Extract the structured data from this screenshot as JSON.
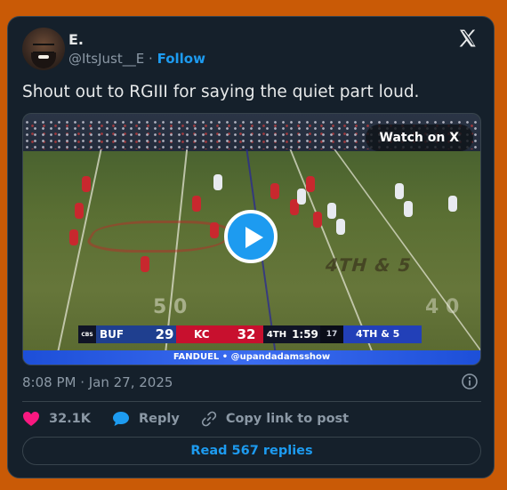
{
  "author": {
    "display_name": "E.",
    "handle": "@ItsJust__E",
    "separator": "·",
    "follow_label": "Follow"
  },
  "tweet": {
    "text": "Shout out to RGIII for saying the quiet part loud.",
    "timestamp": "8:08 PM · Jan 27, 2025"
  },
  "media": {
    "watch_label": "Watch on X",
    "scoreboard": {
      "network": "CBS",
      "away_team": "BUF",
      "away_score": "29",
      "home_team": "KC",
      "home_score": "32",
      "quarter": "4TH",
      "clock": "1:59",
      "play_clock": "17",
      "down": "4TH & 5"
    },
    "field_text": {
      "down_marker": "4TH & 5",
      "yard_50": "5 0",
      "yard_40": "4 0"
    },
    "sponsor_text": "FANDUEL • @upandadamsshow"
  },
  "actions": {
    "likes": "32.1K",
    "reply_label": "Reply",
    "copy_label": "Copy link to post"
  },
  "read_replies_label": "Read 567 replies",
  "colors": {
    "background": "#c95a06",
    "card": "#15202b",
    "accent": "#1d9bf0",
    "like": "#f91880"
  },
  "icons": [
    "x-logo-icon",
    "play-icon",
    "info-icon",
    "heart-icon",
    "reply-icon",
    "link-icon"
  ]
}
